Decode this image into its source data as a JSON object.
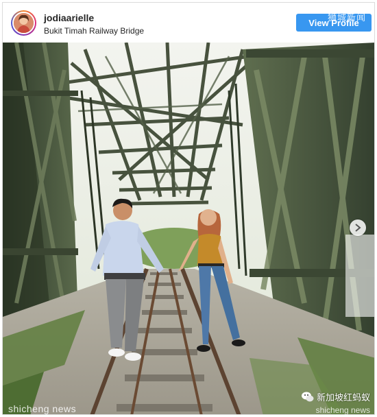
{
  "post": {
    "username": "jodiaarielle",
    "location": "Bukit Timah Railway Bridge",
    "view_profile_label": "View Profile"
  },
  "watermarks": {
    "top_right": "狮城新闻",
    "bottom_left": "shicheng news",
    "bottom_right": "新加坡红蚂蚁",
    "bottom_right_sub": "shicheng news"
  },
  "icons": {
    "avatar": "avatar-icon",
    "carousel_next": "chevron-right-icon",
    "wechat": "wechat-icon"
  },
  "colors": {
    "accent": "#3897f0",
    "bridge_steel": "#4c5a42",
    "sky": "#e9ece4"
  }
}
